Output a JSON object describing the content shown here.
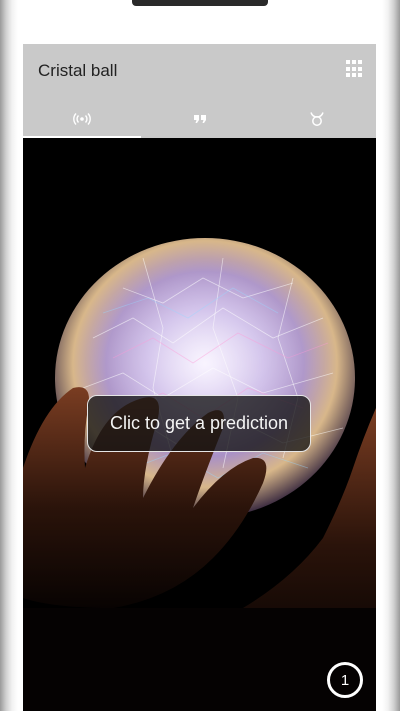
{
  "app": {
    "title": "Cristal ball"
  },
  "toolbar": {
    "menu_icon": "grid-icon"
  },
  "tabs": [
    {
      "icon": "broadcast-icon",
      "active": true
    },
    {
      "icon": "quote-icon",
      "active": false
    },
    {
      "icon": "taurus-icon",
      "active": false
    }
  ],
  "main": {
    "prediction_button": "Clic to get a prediction",
    "counter": "1"
  },
  "colors": {
    "appbar": "#c9c9c9",
    "tab_icon": "#ffffff",
    "background": "#000000"
  }
}
